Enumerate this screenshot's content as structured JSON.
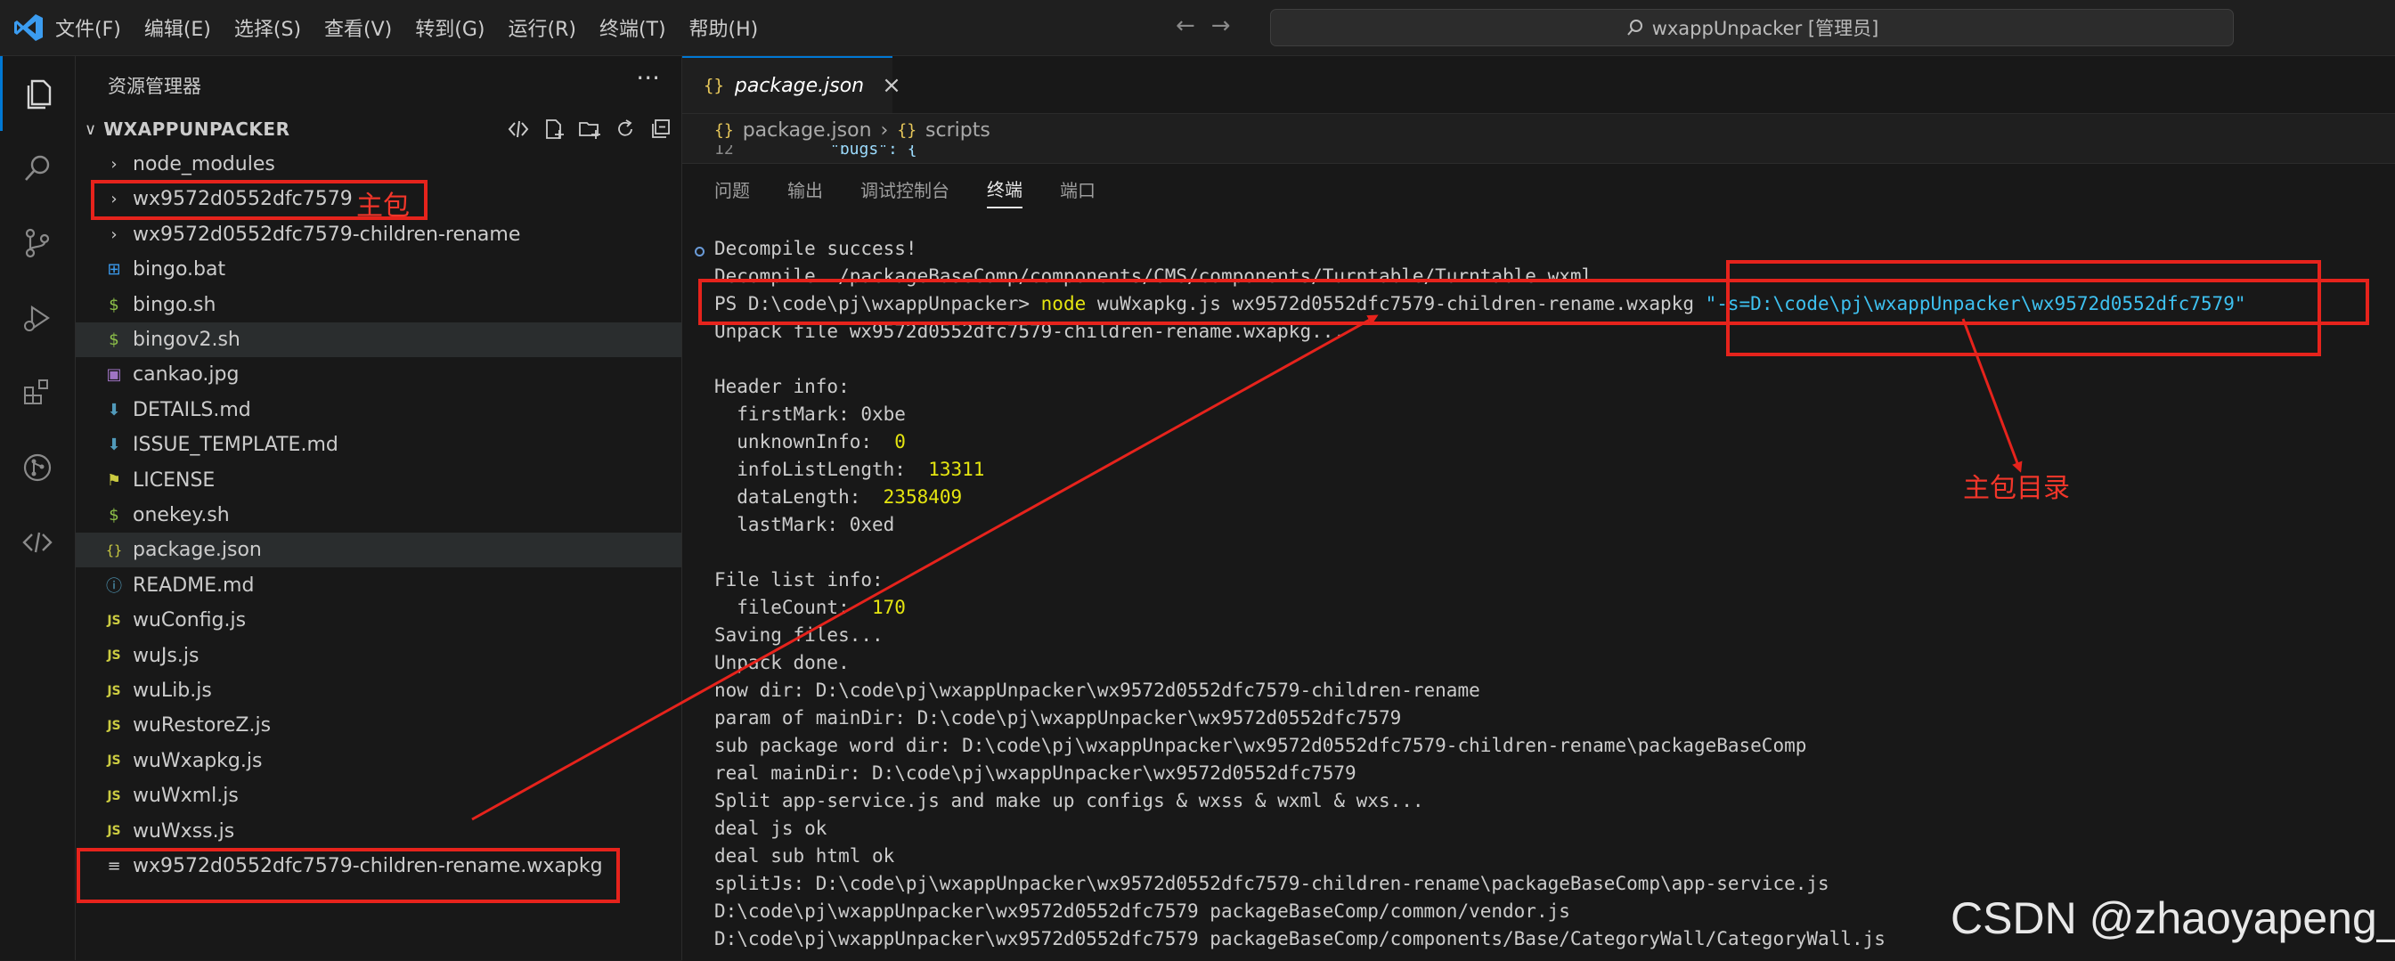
{
  "window": {
    "menu": [
      "文件(F)",
      "编辑(E)",
      "选择(S)",
      "查看(V)",
      "转到(G)",
      "运行(R)",
      "终端(T)",
      "帮助(H)"
    ],
    "search_text": "wxappUnpacker [管理员]"
  },
  "sidebar": {
    "title": "资源管理器",
    "more": "···",
    "root": "WXAPPUNPACKER",
    "items": [
      {
        "label": "node_modules",
        "icon": "›"
      },
      {
        "label": "wx9572d0552dfc7579",
        "icon": "›"
      },
      {
        "label": "wx9572d0552dfc7579-children-rename",
        "icon": "›"
      },
      {
        "label": "bingo.bat",
        "icon": "⊞"
      },
      {
        "label": "bingo.sh",
        "icon": "$"
      },
      {
        "label": "bingov2.sh",
        "icon": "$"
      },
      {
        "label": "cankao.jpg",
        "icon": "▣"
      },
      {
        "label": "DETAILS.md",
        "icon": "⬇"
      },
      {
        "label": "ISSUE_TEMPLATE.md",
        "icon": "⬇"
      },
      {
        "label": "LICENSE",
        "icon": "⚑"
      },
      {
        "label": "onekey.sh",
        "icon": "$"
      },
      {
        "label": "package.json",
        "icon": "{}"
      },
      {
        "label": "README.md",
        "icon": "ⓘ"
      },
      {
        "label": "wuConfig.js",
        "icon": "JS"
      },
      {
        "label": "wuJs.js",
        "icon": "JS"
      },
      {
        "label": "wuLib.js",
        "icon": "JS"
      },
      {
        "label": "wuRestoreZ.js",
        "icon": "JS"
      },
      {
        "label": "wuWxapkg.js",
        "icon": "JS"
      },
      {
        "label": "wuWxml.js",
        "icon": "JS"
      },
      {
        "label": "wuWxss.js",
        "icon": "JS"
      },
      {
        "label": "wx9572d0552dfc7579-children-rename.wxapkg",
        "icon": "≡"
      }
    ]
  },
  "editor": {
    "tab_icon": "{}",
    "tab_label": "package.json",
    "tab_close": "×",
    "breadcrumb": [
      "package.json",
      "scripts"
    ],
    "breadcrumb_sep": "›",
    "peek_line_no": "12",
    "peek_code": "\"bugs\": {"
  },
  "panel": {
    "tabs": [
      "问题",
      "输出",
      "调试控制台",
      "终端",
      "端口"
    ],
    "active_tab": "终端"
  },
  "terminal": {
    "lines": [
      {
        "parts": [
          {
            "t": "Decompile success!"
          }
        ]
      },
      {
        "parts": [
          {
            "t": "Decompile ./packageBaseComp/components/CMS/components/Turntable/Turntable.wxml"
          }
        ]
      },
      {
        "parts": [
          {
            "t": "PS D:\\code\\pj\\wxappUnpacker> "
          },
          {
            "t": "node",
            "c": "yellow"
          },
          {
            "t": " wuWxapkg.js wx9572d0552dfc7579-children-rename.wxapkg "
          },
          {
            "t": "\"-s=D:\\code\\pj\\wxappUnpacker\\wx9572d0552dfc7579\"",
            "c": "cyan"
          }
        ]
      },
      {
        "parts": [
          {
            "t": "Unpack file wx9572d0552dfc7579-children-rename.wxapkg..."
          }
        ]
      },
      {
        "parts": [
          {
            "t": ""
          }
        ]
      },
      {
        "parts": [
          {
            "t": "Header info:"
          }
        ]
      },
      {
        "parts": [
          {
            "t": "  firstMark: 0xbe"
          }
        ]
      },
      {
        "parts": [
          {
            "t": "  unknownInfo:  "
          },
          {
            "t": "0",
            "c": "yellow"
          }
        ]
      },
      {
        "parts": [
          {
            "t": "  infoListLength:  "
          },
          {
            "t": "13311",
            "c": "yellow"
          }
        ]
      },
      {
        "parts": [
          {
            "t": "  dataLength:  "
          },
          {
            "t": "2358409",
            "c": "yellow"
          }
        ]
      },
      {
        "parts": [
          {
            "t": "  lastMark: 0xed"
          }
        ]
      },
      {
        "parts": [
          {
            "t": ""
          }
        ]
      },
      {
        "parts": [
          {
            "t": "File list info:"
          }
        ]
      },
      {
        "parts": [
          {
            "t": "  fileCount:  "
          },
          {
            "t": "170",
            "c": "yellow"
          }
        ]
      },
      {
        "parts": [
          {
            "t": "Saving files..."
          }
        ]
      },
      {
        "parts": [
          {
            "t": "Unpack done."
          }
        ]
      },
      {
        "parts": [
          {
            "t": "now dir: D:\\code\\pj\\wxappUnpacker\\wx9572d0552dfc7579-children-rename"
          }
        ]
      },
      {
        "parts": [
          {
            "t": "param of mainDir: D:\\code\\pj\\wxappUnpacker\\wx9572d0552dfc7579"
          }
        ]
      },
      {
        "parts": [
          {
            "t": "sub package word dir: D:\\code\\pj\\wxappUnpacker\\wx9572d0552dfc7579-children-rename\\packageBaseComp"
          }
        ]
      },
      {
        "parts": [
          {
            "t": "real mainDir: D:\\code\\pj\\wxappUnpacker\\wx9572d0552dfc7579"
          }
        ]
      },
      {
        "parts": [
          {
            "t": "Split app-service.js and make up configs & wxss & wxml & wxs..."
          }
        ]
      },
      {
        "parts": [
          {
            "t": "deal js ok"
          }
        ]
      },
      {
        "parts": [
          {
            "t": "deal sub html ok"
          }
        ]
      },
      {
        "parts": [
          {
            "t": "splitJs: D:\\code\\pj\\wxappUnpacker\\wx9572d0552dfc7579-children-rename\\packageBaseComp\\app-service.js"
          }
        ]
      },
      {
        "parts": [
          {
            "t": "D:\\code\\pj\\wxappUnpacker\\wx9572d0552dfc7579 packageBaseComp/common/vendor.js"
          }
        ]
      },
      {
        "parts": [
          {
            "t": "D:\\code\\pj\\wxappUnpacker\\wx9572d0552dfc7579 packageBaseComp/components/Base/CategoryWall/CategoryWall.js"
          }
        ]
      }
    ]
  },
  "annotations": {
    "main_package": "主包",
    "main_package_dir": "主包目录"
  },
  "watermark": "CSDN @zhaoyapeng_"
}
